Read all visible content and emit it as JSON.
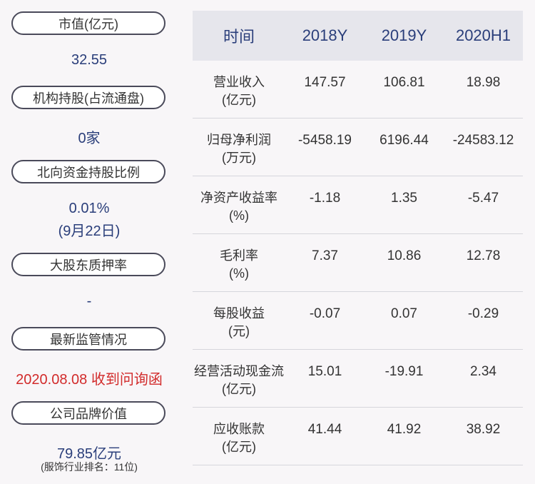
{
  "left_panel": {
    "items": [
      {
        "label": "市值(亿元)",
        "value": "32.55",
        "sub": ""
      },
      {
        "label": "机构持股(占流通盘)",
        "value": "0家",
        "sub": ""
      },
      {
        "label": "北向资金持股比例",
        "value": "0.01%",
        "value2": "(9月22日)",
        "sub": ""
      },
      {
        "label": "大股东质押率",
        "value": "-",
        "sub": ""
      },
      {
        "label": "最新监管情况",
        "value": "2020.08.08 收到问询函",
        "sub": ""
      },
      {
        "label": "公司品牌价值",
        "value": "79.85亿元",
        "sub": "(服饰行业排名：11位)"
      }
    ]
  },
  "table": {
    "headers": [
      "时间",
      "2018Y",
      "2019Y",
      "2020H1"
    ],
    "rows": [
      {
        "label1": "营业收入",
        "label2": "(亿元)",
        "values": [
          "147.57",
          "106.81",
          "18.98"
        ]
      },
      {
        "label1": "归母净利润",
        "label2": "(万元)",
        "values": [
          "-5458.19",
          "6196.44",
          "-24583.12"
        ]
      },
      {
        "label1": "净资产收益率",
        "label2": "(%)",
        "values": [
          "-1.18",
          "1.35",
          "-5.47"
        ]
      },
      {
        "label1": "毛利率",
        "label2": "(%)",
        "values": [
          "7.37",
          "10.86",
          "12.78"
        ]
      },
      {
        "label1": "每股收益",
        "label2": "(元)",
        "values": [
          "-0.07",
          "0.07",
          "-0.29"
        ]
      },
      {
        "label1": "经营活动现金流",
        "label2": "(亿元)",
        "values": [
          "15.01",
          "-19.91",
          "2.34"
        ]
      },
      {
        "label1": "应收账款",
        "label2": "(亿元)",
        "values": [
          "41.44",
          "41.92",
          "38.92"
        ]
      }
    ]
  },
  "colors": {
    "accent": "#2a3e7a",
    "alert": "#d22b2b",
    "header_bg": "#e6e6ec"
  }
}
